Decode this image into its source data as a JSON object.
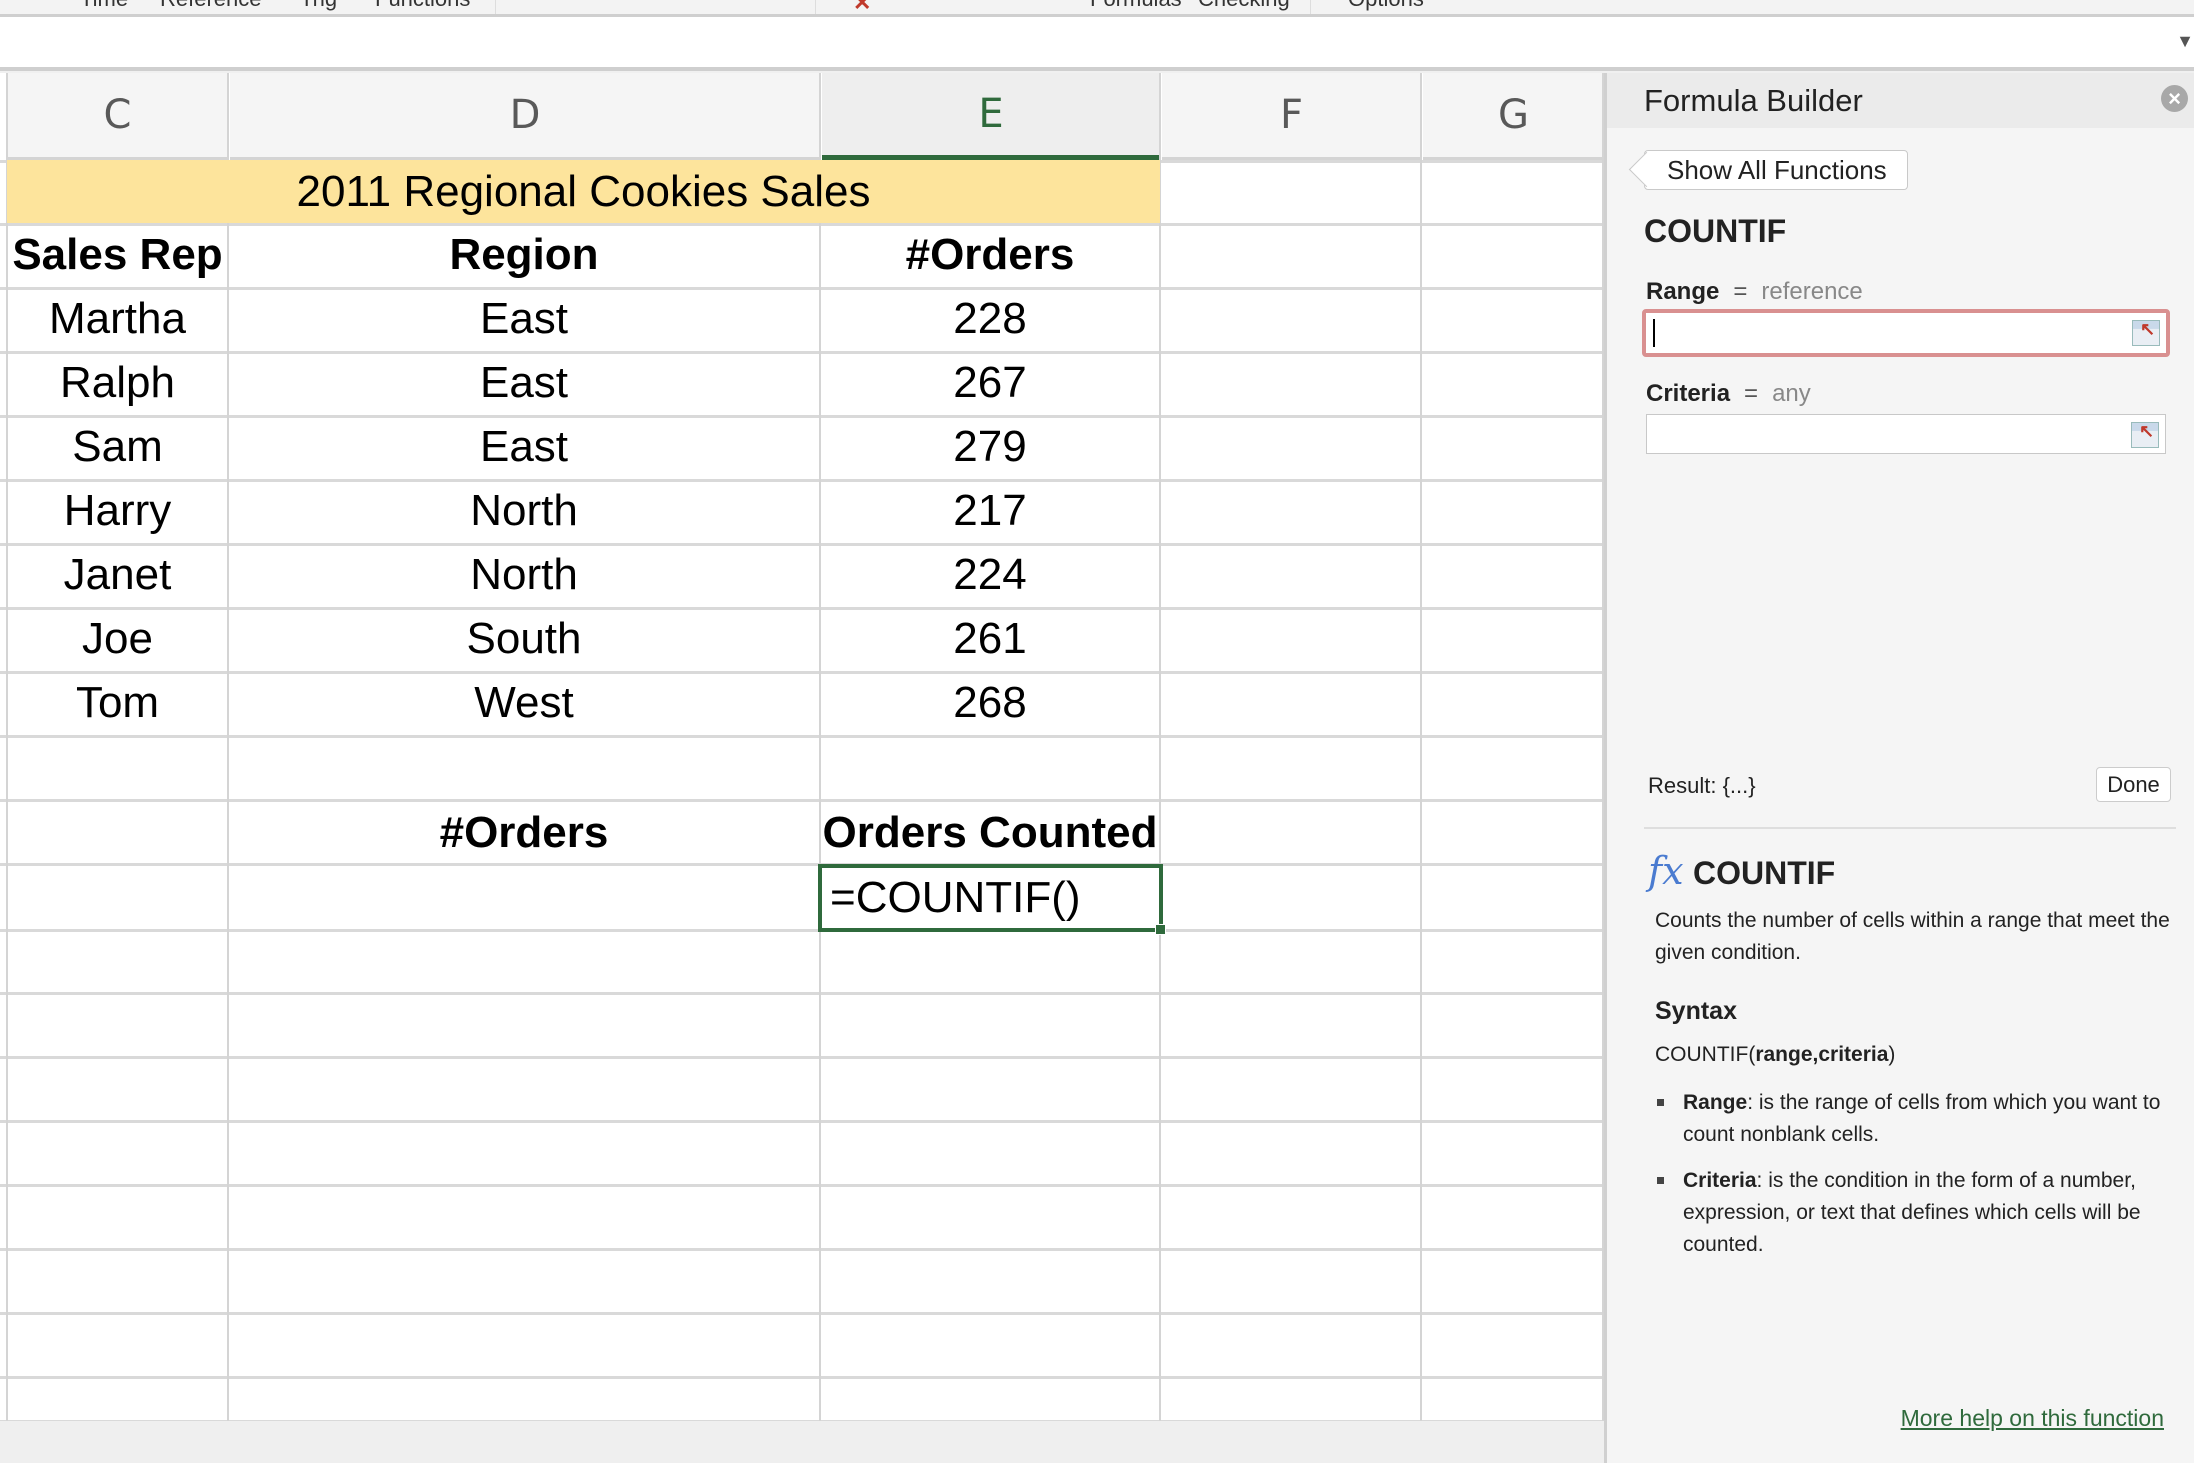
{
  "toolbar": {
    "items": [
      "Time",
      "Reference",
      "Trig",
      "Functions",
      "Formulas",
      "Checking",
      "Options"
    ]
  },
  "formula_bar": {
    "value": ""
  },
  "columns": [
    "C",
    "D",
    "E",
    "F",
    "G"
  ],
  "selected_column": "E",
  "sheet": {
    "title": "2011 Regional Cookies Sales",
    "headers": [
      "Sales Rep",
      "Region",
      "#Orders"
    ],
    "rows": [
      {
        "rep": "Martha",
        "region": "East",
        "orders": "228"
      },
      {
        "rep": "Ralph",
        "region": "East",
        "orders": "267"
      },
      {
        "rep": "Sam",
        "region": "East",
        "orders": "279"
      },
      {
        "rep": "Harry",
        "region": "North",
        "orders": "217"
      },
      {
        "rep": "Janet",
        "region": "North",
        "orders": "224"
      },
      {
        "rep": "Joe",
        "region": "South",
        "orders": "261"
      },
      {
        "rep": "Tom",
        "region": "West",
        "orders": "268"
      }
    ],
    "summary_label_d": "#Orders",
    "summary_label_e": "Orders Counted",
    "active_cell_formula": "=COUNTIF()"
  },
  "formula_builder": {
    "title": "Formula Builder",
    "close_icon": "close-circle-icon",
    "back_button": "Show All Functions",
    "function_name": "COUNTIF",
    "args": [
      {
        "name": "Range",
        "eq": "=",
        "hint": "reference",
        "value": ""
      },
      {
        "name": "Criteria",
        "eq": "=",
        "hint": "any",
        "value": ""
      }
    ],
    "result_label": "Result: {...}",
    "done_button": "Done",
    "help": {
      "fx_symbol": "fx",
      "name": "COUNTIF",
      "description": "Counts the number of cells within a range that meet the given condition.",
      "syntax_heading": "Syntax",
      "syntax_fn": "COUNTIF(",
      "syntax_args": "range,criteria",
      "syntax_close": ")",
      "bullets": [
        {
          "term": "Range",
          "text": ": is the range of cells from which you want to count nonblank cells."
        },
        {
          "term": "Criteria",
          "text": ": is the condition in the form of a number, expression, or text that defines which cells will be counted."
        }
      ],
      "more_help_link": "More help on this function"
    }
  },
  "colors": {
    "accent_green": "#2f6a3c",
    "title_band": "#fde49c",
    "active_input_border": "#d99090",
    "fx_blue": "#4a7bd0"
  }
}
